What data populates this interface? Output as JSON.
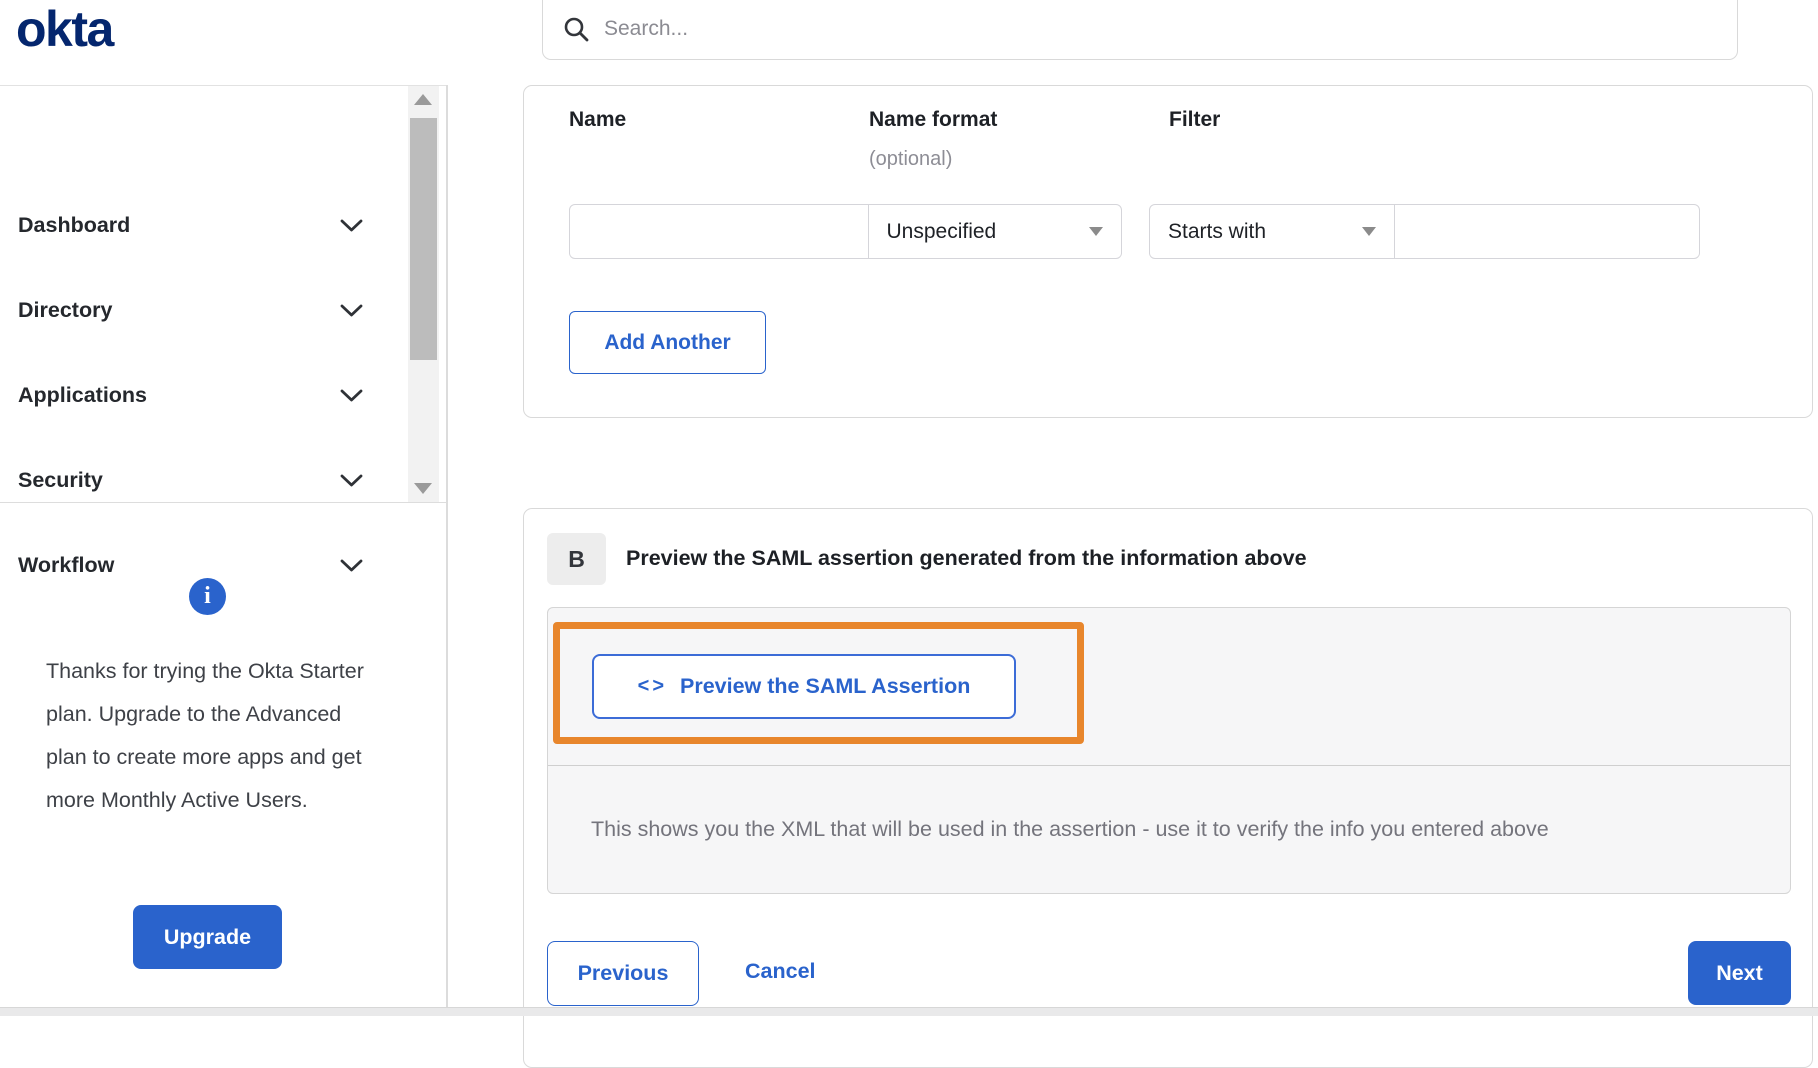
{
  "brand": {
    "logo": "okta"
  },
  "search": {
    "placeholder": "Search..."
  },
  "sidebar": {
    "items": [
      {
        "label": "Dashboard"
      },
      {
        "label": "Directory"
      },
      {
        "label": "Applications"
      },
      {
        "label": "Security"
      },
      {
        "label": "Workflow"
      }
    ],
    "upgrade": {
      "text": "Thanks for trying the Okta Starter plan. Upgrade to the Advanced plan to create more apps and get more Monthly Active Users.",
      "button": "Upgrade"
    }
  },
  "form": {
    "columns": [
      {
        "label": "Name"
      },
      {
        "label": "Name format",
        "sub": "(optional)"
      },
      {
        "label": "Filter"
      }
    ],
    "name_value": "",
    "name_format_value": "Unspecified",
    "filter_operator_value": "Starts with",
    "filter_value": "",
    "add_another": "Add Another"
  },
  "section_b": {
    "badge": "B",
    "title": "Preview the SAML assertion generated from the information above",
    "preview_icon": "<>",
    "preview_button": "Preview the SAML Assertion",
    "hint": "This shows you the XML that will be used in the assertion - use it to verify the info you entered above"
  },
  "footer": {
    "previous": "Previous",
    "cancel": "Cancel",
    "next": "Next"
  },
  "colors": {
    "accent_blue": "#2a63cc",
    "logo_navy": "#04266e",
    "highlight_orange": "#e8862c",
    "hint_gray": "#74747c"
  }
}
